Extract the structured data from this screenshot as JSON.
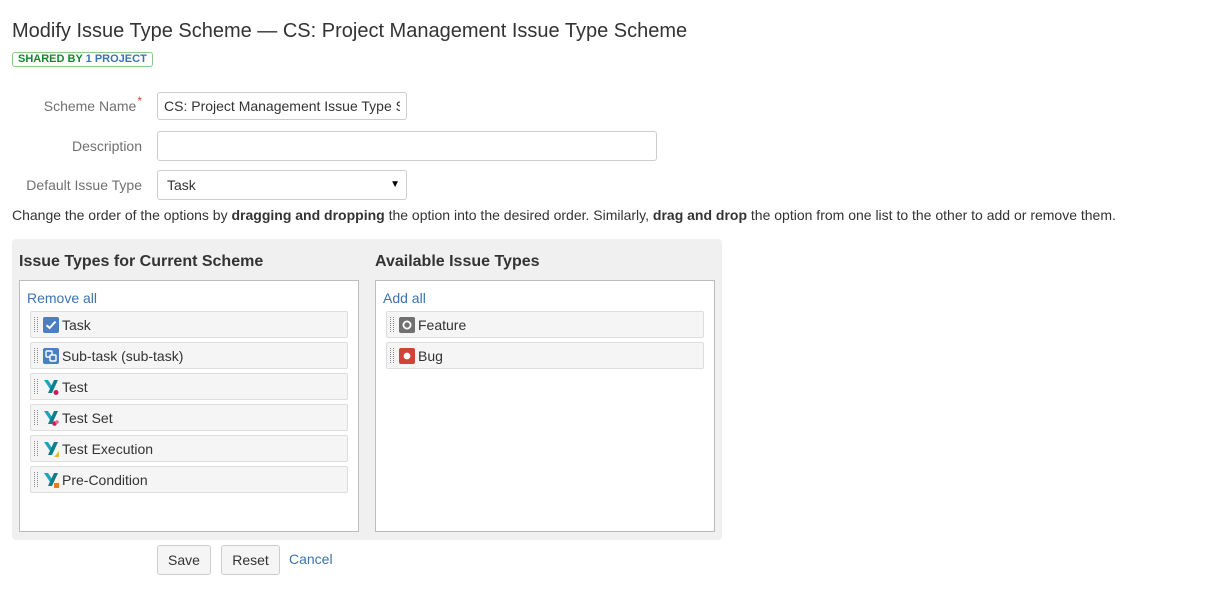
{
  "header": {
    "title": "Modify Issue Type Scheme — CS: Project Management Issue Type Scheme",
    "badge_prefix": "SHARED BY",
    "badge_count": "1 PROJECT"
  },
  "form": {
    "scheme_name_label": "Scheme Name",
    "required_marker": "*",
    "scheme_name_value": "CS: Project Management Issue Type Scheme",
    "description_label": "Description",
    "description_value": "",
    "default_issue_type_label": "Default Issue Type",
    "default_issue_type_value": "Task"
  },
  "instructions": {
    "part1": "Change the order of the options by ",
    "bold1": "dragging and dropping",
    "part2": " the option into the desired order. Similarly, ",
    "bold2": "drag and drop",
    "part3": " the option from one list to the other to add or remove them."
  },
  "current_scheme": {
    "heading": "Issue Types for Current Scheme",
    "action": "Remove all",
    "items": [
      {
        "label": "Task",
        "icon": "task-icon"
      },
      {
        "label": "Sub-task (sub-task)",
        "icon": "subtask-icon"
      },
      {
        "label": "Test",
        "icon": "xray-test-icon"
      },
      {
        "label": "Test Set",
        "icon": "xray-test-set-icon"
      },
      {
        "label": "Test Execution",
        "icon": "xray-test-execution-icon"
      },
      {
        "label": "Pre-Condition",
        "icon": "xray-precondition-icon"
      }
    ]
  },
  "available": {
    "heading": "Available Issue Types",
    "action": "Add all",
    "items": [
      {
        "label": "Feature",
        "icon": "feature-icon"
      },
      {
        "label": "Bug",
        "icon": "bug-icon"
      }
    ]
  },
  "buttons": {
    "save": "Save",
    "reset": "Reset",
    "cancel": "Cancel"
  },
  "colors": {
    "link": "#3b73af",
    "badge_green": "#14892c",
    "required": "#d04437",
    "task_blue": "#4a7fc1",
    "bug_red": "#d04437",
    "feature_gray": "#707070",
    "xray_teal": "#1ba5b8"
  }
}
